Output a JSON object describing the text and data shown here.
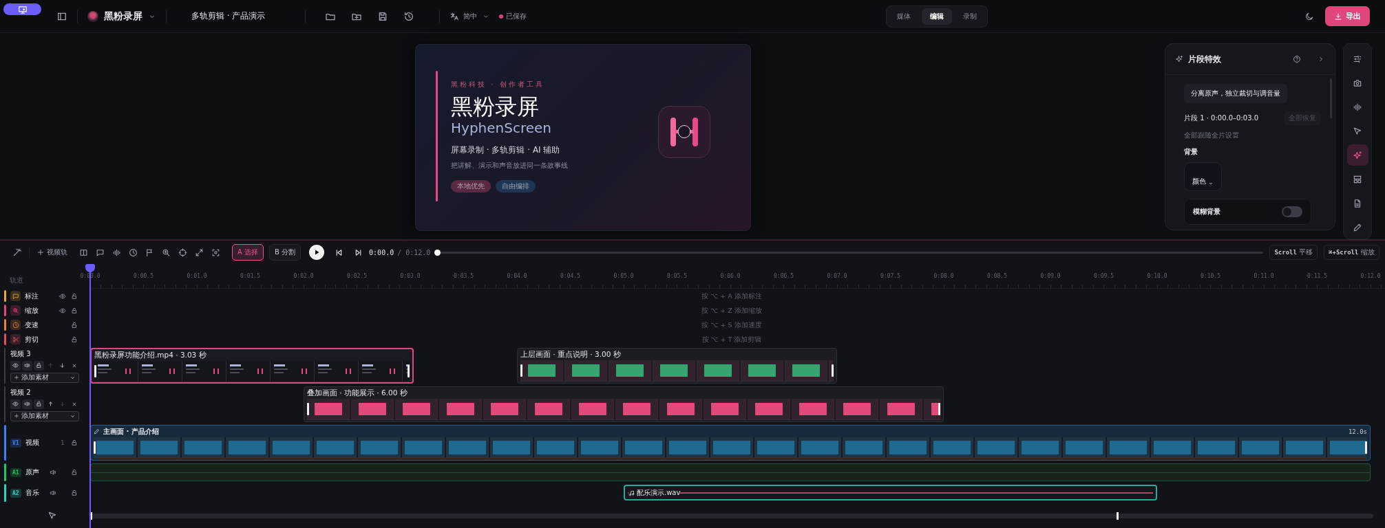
{
  "top_bar": {
    "app_name": "黑粉录屏",
    "project_title": "多轨剪辑 · 产品演示",
    "language": "简中",
    "save_status": "已保存",
    "mode_tabs": [
      {
        "label": "媒体",
        "selected": false
      },
      {
        "label": "编辑",
        "selected": true
      },
      {
        "label": "录制",
        "selected": false
      }
    ],
    "export_button": "导出"
  },
  "preview": {
    "eyebrow": "黑粉科技 · 创作者工具",
    "title": "黑粉录屏",
    "subtitle": "HyphenScreen",
    "features": "屏幕录制 · 多轨剪辑 · AI 辅助",
    "tagline": "把讲解、演示和声音放进同一条故事线",
    "tags": [
      {
        "label": "本地优先",
        "color": "#5a2a44"
      },
      {
        "label": "自由编排",
        "color": "#1f3552"
      }
    ]
  },
  "effects_panel": {
    "title": "片段特效",
    "separate_audio_button": "分离原声，独立裁切与调音量",
    "segment_label": "片段 1 · 0:00.0–0:03.0",
    "reset_button": {
      "label": "全部恢复",
      "disabled": true
    },
    "follow_note": "全部跟随全片设置",
    "background_label": "背景",
    "background_type": "颜色",
    "blur_background": {
      "label": "模糊背景",
      "on": false
    }
  },
  "side_tools": [
    {
      "kind": "sliders",
      "selected": false
    },
    {
      "kind": "camera",
      "selected": false
    },
    {
      "kind": "waveform",
      "selected": false
    },
    {
      "kind": "cursor",
      "selected": false
    },
    {
      "kind": "sparkle",
      "selected": true
    },
    {
      "kind": "layout",
      "selected": false
    },
    {
      "kind": "document",
      "selected": false
    },
    {
      "kind": "pen",
      "selected": false
    }
  ],
  "timeline": {
    "toolbar": {
      "add_track_button": "视频轨",
      "select_tool": {
        "label": "A 选择",
        "selected": true
      },
      "split_tool": {
        "label": "B 分割",
        "selected": false
      },
      "current_time": "0:00.0",
      "total_time": "/ 0:12.0",
      "playback": {
        "level": 0
      },
      "scroll_hints": [
        {
          "key": "Scroll",
          "action": "平移"
        },
        {
          "key": "⌘+Scroll",
          "action": "缩放"
        }
      ]
    },
    "tracks_header": "轨道",
    "ruler": [
      "0:00.0",
      "0:00.5",
      "0:01.0",
      "0:01.5",
      "0:02.0",
      "0:02.5",
      "0:03.0",
      "0:03.5",
      "0:04.0",
      "0:04.5",
      "0:05.0",
      "0:05.5",
      "0:06.0",
      "0:06.5",
      "0:07.0",
      "0:07.5",
      "0:08.0",
      "0:08.5",
      "0:09.0",
      "0:09.5",
      "0:10.0",
      "0:10.5",
      "0:11.0",
      "0:11.5",
      "0:12.0"
    ],
    "tracks": [
      {
        "kind": "annotation",
        "name": "标注",
        "color": "#e8a93a",
        "eye": true,
        "hint": "按 ⌥ + A 添加标注"
      },
      {
        "kind": "zoom",
        "name": "缩放",
        "color": "#e0457b",
        "eye": true,
        "hint": "按 ⌥ + Z 添加缩放"
      },
      {
        "kind": "speed",
        "name": "变速",
        "color": "#e8823a",
        "eye": false,
        "hint": "按 ⌥ + S 添加速度"
      },
      {
        "kind": "cut",
        "name": "剪切",
        "color": "#e0505a",
        "eye": false,
        "hint": "按 ⌥ + T 添加剪辑"
      },
      {
        "kind": "overlay",
        "name": "视频 3",
        "can_move_up": false,
        "can_move_down": true,
        "add_media": "添加素材",
        "clips": [
          {
            "kind": "screen",
            "label": "黑粉录屏功能介绍.mp4 · 3.03 秒",
            "selected": true
          },
          {
            "kind": "frames",
            "label": "上层画面 · 重点说明 · 3.00 秒",
            "color": "#34a56f",
            "selected": false
          }
        ]
      },
      {
        "kind": "overlay",
        "name": "视频 2",
        "can_move_up": true,
        "can_move_down": false,
        "add_media": "添加素材",
        "clips": [
          {
            "kind": "frames",
            "label": "叠加画面 · 功能展示 · 6.00 秒",
            "color": "#e0497a",
            "selected": false
          }
        ]
      },
      {
        "kind": "main",
        "badge": "V1",
        "name": "视频",
        "count": "1",
        "color": "#3b82f6",
        "clips": [
          {
            "kind": "main",
            "label": "主画面 · 产品介绍",
            "end_label": "12.0s",
            "color": "#1f6a91",
            "selected": false
          }
        ]
      },
      {
        "kind": "audio",
        "badge": "A1",
        "name": "原声",
        "color": "#22c55e",
        "clips": [
          {
            "kind": "empty",
            "selected": false
          }
        ]
      },
      {
        "kind": "audio",
        "badge": "A2",
        "name": "音乐",
        "color": "#2dd4bf",
        "clips": [
          {
            "kind": "music",
            "label": "配乐演示.wav",
            "selected": false
          }
        ]
      }
    ]
  }
}
